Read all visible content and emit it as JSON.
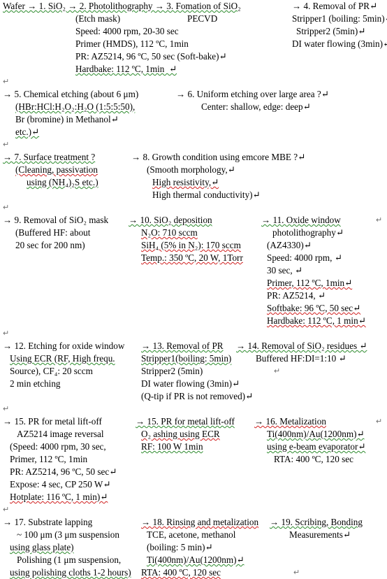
{
  "document": {
    "type": "process-flow-notes",
    "title_line": "Wafer → 1. SiO2 → 2. Photolithography → 3. Fomation of SiO2 → 4. Removal of PR",
    "paragraph_mark": "↵",
    "colors": {
      "text": "#000000",
      "spell_error_underline": "#d02020",
      "grammar_error_underline": "#2d8b2d",
      "paragraph_mark": "#6f6f6f",
      "page_background": "#ffffff"
    }
  },
  "sections": [
    {
      "id": "section-1",
      "columns": [
        {
          "id": "col-1-1",
          "lines": [
            "Wafer → 1. SiO₂ → 2. Photolithography → 3. Fomation of SiO₂",
            "(Etch mask)",
            "Speed: 4000 rpm, 20-30 sec",
            "Primer (HMDS), 112 ºC, 1min",
            "PR: AZ5214, 96 ºC, 50 sec (Soft-bake)↵",
            "Hardbake: 112 ºC, 1min  ↵"
          ]
        },
        {
          "id": "col-1-2",
          "lines": [
            "PECVD"
          ]
        },
        {
          "id": "col-1-3",
          "lines": [
            "→ 4. Removal of PR↵",
            "Stripper1 (boiling: 5min)↵",
            "Stripper2 (5min)↵",
            "DI water flowing (3min)↵"
          ]
        }
      ]
    },
    {
      "id": "section-2",
      "columns": [
        {
          "id": "col-2-1",
          "lines": [
            "→ 5. Chemical etching (about 6 μm)",
            "(HBr:HCl:H₂O₂:H₂O (1:5:5:50),",
            "Br (bromine) in Methanol↵",
            "etc.)↵"
          ]
        },
        {
          "id": "col-2-2",
          "lines": [
            "→ 6. Uniform etching over large area ?↵",
            "Center: shallow, edge: deep↵"
          ]
        }
      ]
    },
    {
      "id": "section-3",
      "columns": [
        {
          "id": "col-3-1",
          "lines": [
            "→ 7. Surface treatment ?",
            "(Cleaning, passivation",
            "using (NH₄)₂S etc.)"
          ]
        },
        {
          "id": "col-3-2",
          "lines": [
            "→ 8. Growth condition using emcore MBE ?↵",
            "(Smooth morphology,↵",
            "High resistivity,↵",
            "High thermal conductivity)↵"
          ]
        }
      ]
    },
    {
      "id": "section-4",
      "columns": [
        {
          "id": "col-4-1",
          "lines": [
            "→ 9. Removal of SiO₂ mask",
            "(Buffered HF: about",
            "20 sec for 200 nm)"
          ]
        },
        {
          "id": "col-4-2",
          "lines": [
            "→ 10. SiO₂ deposition",
            "N₂O: 710 sccm",
            "SiH₄ (5% in N₂): 170 sccm",
            "Temp.: 350 ºC, 20 W, 1Torr"
          ]
        },
        {
          "id": "col-4-3",
          "lines": [
            "→ 11. Oxide window",
            "photolithography↵",
            "(AZ4330)↵",
            "Speed: 4000 rpm, ↵",
            "30 sec, ↵",
            "Primer, 112 ºC, 1min↵",
            "PR: AZ5214, ↵",
            "Softbake: 96 ºC, 50 sec↵",
            "Hardbake: 112 ºC, 1 min↵"
          ]
        }
      ]
    },
    {
      "id": "section-5",
      "columns": [
        {
          "id": "col-5-1",
          "lines": [
            "→ 12. Etching for oxide window",
            "Using ECR (RF, High frequ.",
            "Source), CF₄: 20 sccm",
            "2 min etching"
          ]
        },
        {
          "id": "col-5-2",
          "lines": [
            "→ 13. Removal of PR",
            "Stripper1(boiling: 5min)",
            "Stripper2 (5min)",
            "DI water flowing (3min)↵",
            "(Q-tip if PR is not removed)↵"
          ]
        },
        {
          "id": "col-5-3",
          "lines": [
            "→ 14. Removal of SiO₂ residues ↵",
            "Buffered HF:DI=1:10 ↵",
            "↵"
          ]
        }
      ]
    },
    {
      "id": "section-6",
      "columns": [
        {
          "id": "col-6-1",
          "lines": [
            "→ 15. PR for metal lift-off",
            "AZ5214 image reversal",
            "(Speed: 4000 rpm, 30 sec,",
            "Primer, 112 ºC, 1min",
            "PR: AZ5214, 96 ºC, 50 sec↵",
            "Expose: 4 sec, CP 250 W↵",
            "Hotplate: 116 ºC, 1 min)↵"
          ]
        },
        {
          "id": "col-6-2",
          "lines": [
            "→ 15. PR for metal lift-off",
            "O₂ ashing using ECR",
            "RF: 100 W 1min"
          ]
        },
        {
          "id": "col-6-3",
          "lines": [
            "→ 16. Metalization",
            "Ti(400nm)/Au(1200nm)↵",
            "using e-beam evaporator↵",
            "RTA: 400 ºC, 120 sec"
          ]
        }
      ]
    },
    {
      "id": "section-7",
      "columns": [
        {
          "id": "col-7-1",
          "lines": [
            "→ 17. Substrate lapping",
            "~ 100 μm (3 μm suspension",
            "using glass plate)",
            "Polishing (1 μm suspension,",
            "using polishing cloths 1-2 hours)"
          ]
        },
        {
          "id": "col-7-2",
          "lines": [
            "→ 18. Rinsing and metalization",
            "TCE, acetone, methanol",
            "(boiling: 5 min)↵",
            "Ti(400nm)/Au(1200nm)↵",
            "RTA: 400 ºC, 120 sec"
          ]
        },
        {
          "id": "col-7-3",
          "lines": [
            "→ 19. Scribing, Bonding",
            "Measurements↵",
            "↵"
          ]
        }
      ]
    }
  ]
}
